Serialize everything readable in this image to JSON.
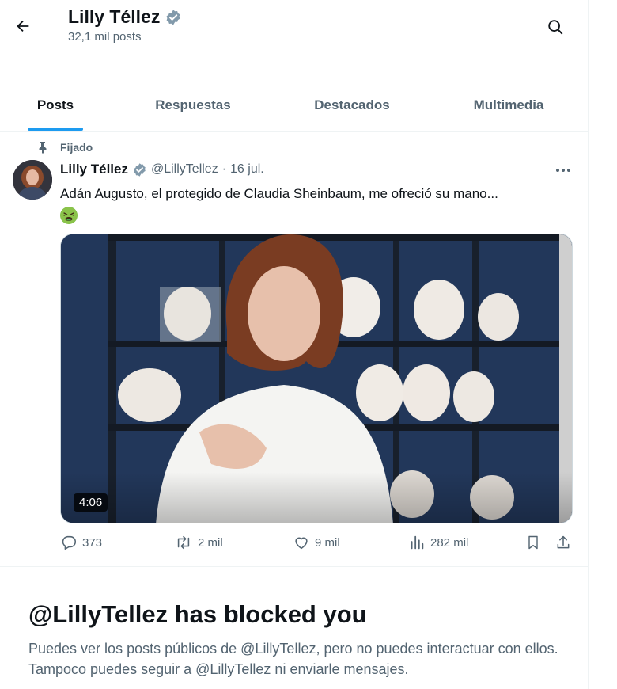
{
  "header": {
    "title": "Lilly Téllez",
    "subtitle": "32,1 mil posts"
  },
  "tabs": [
    {
      "label": "Posts",
      "active": true
    },
    {
      "label": "Respuestas",
      "active": false
    },
    {
      "label": "Destacados",
      "active": false
    },
    {
      "label": "Multimedia",
      "active": false
    }
  ],
  "post": {
    "pinned_label": "Fijado",
    "author": "Lilly Téllez",
    "handle": "@LillyTellez",
    "separator": "·",
    "date": "16 jul.",
    "text": "Adán Augusto, el protegido de Claudia Sheinbaum, me ofreció su mano...",
    "emoji_icon": "nauseated-face-icon",
    "video_duration": "4:06",
    "actions": {
      "replies": "373",
      "reposts": "2 mil",
      "likes": "9 mil",
      "views": "282 mil"
    }
  },
  "blocked": {
    "title": "@LillyTellez has blocked you",
    "text": "Puedes ver los posts públicos de @LillyTellez, pero no puedes interactuar con ellos. Tampoco puedes seguir a @LillyTellez ni enviarle mensajes."
  },
  "colors": {
    "accent": "#1d9bf0",
    "text_primary": "#0f1419",
    "text_secondary": "#536471",
    "border": "#eff3f4",
    "verified": "#829aab"
  }
}
